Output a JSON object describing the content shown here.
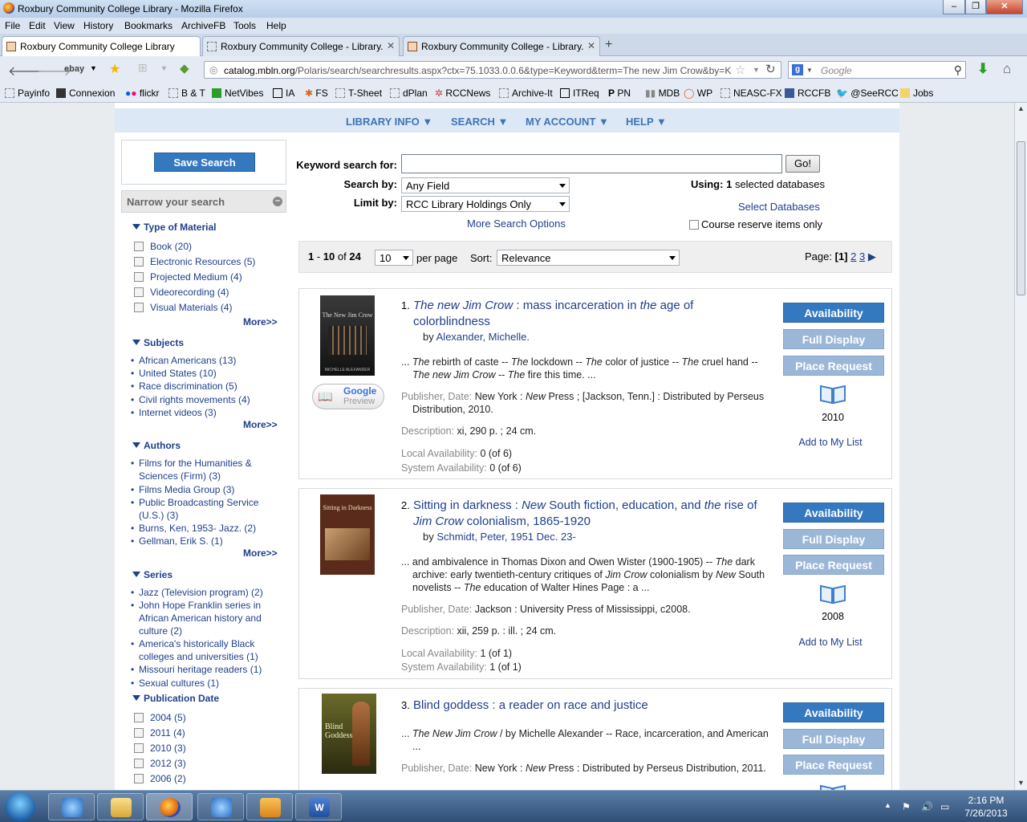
{
  "window": {
    "title": "Roxbury Community College Library - Mozilla Firefox"
  },
  "menu": [
    "File",
    "Edit",
    "View",
    "History",
    "Bookmarks",
    "ArchiveFB",
    "Tools",
    "Help"
  ],
  "tabs": [
    {
      "label": "Roxbury Community College Library",
      "active": true
    },
    {
      "label": "Roxbury Community College - Library.",
      "active": false
    },
    {
      "label": "Roxbury Community College - Library.",
      "active": false
    }
  ],
  "nav": {
    "url_domain": "catalog.mbln.org",
    "url_path": "/Polaris/search/searchresults.aspx?ctx=75.1033.0.0.6&type=Keyword&term=The new Jim Crow&by=K",
    "ebay": "ebay",
    "search_placeholder": "Google"
  },
  "bookmarks": [
    "Payinfo",
    "Connexion",
    "flickr",
    "B & T",
    "NetVibes",
    "IA",
    "FS",
    "T-Sheet",
    "dPlan",
    "RCCNews",
    "Archive-It",
    "ITReq",
    "PN",
    "MDB",
    "WP",
    "NEASC-FX",
    "RCCFB",
    "@SeeRCC",
    "Jobs"
  ],
  "site_nav": [
    "LIBRARY INFO ▼",
    "SEARCH ▼",
    "MY ACCOUNT ▼",
    "HELP ▼"
  ],
  "sidebar": {
    "save_search": "Save Search",
    "narrow_title": "Narrow your search",
    "more": "More>>",
    "type_of_material": {
      "title": "Type of Material",
      "items": [
        "Book (20)",
        "Electronic Resources (5)",
        "Projected Medium (4)",
        "Videorecording (4)",
        "Visual Materials (4)"
      ]
    },
    "subjects": {
      "title": "Subjects",
      "items": [
        "African Americans (13)",
        "United States (10)",
        "Race discrimination (5)",
        "Civil rights movements (4)",
        "Internet videos (3)"
      ]
    },
    "authors": {
      "title": "Authors",
      "items": [
        "Films for the Humanities & Sciences (Firm) (3)",
        "Films Media Group (3)",
        "Public Broadcasting Service (U.S.) (3)",
        "Burns, Ken, 1953- Jazz. (2)",
        "Gellman, Erik S. (1)"
      ]
    },
    "series": {
      "title": "Series",
      "items": [
        "Jazz (Television program) (2)",
        "John Hope Franklin series in African American history and culture (2)",
        "America's historically Black colleges and universities (1)",
        "Missouri heritage readers (1)",
        "Sexual cultures (1)"
      ]
    },
    "pub_date": {
      "title": "Publication Date",
      "items": [
        "2004 (5)",
        "2011 (4)",
        "2010 (3)",
        "2012 (3)",
        "2006 (2)"
      ]
    }
  },
  "search": {
    "keyword_label": "Keyword search for:",
    "keyword_value": "",
    "go": "Go!",
    "search_by_label": "Search by:",
    "search_by_value": "Any Field",
    "limit_by_label": "Limit by:",
    "limit_by_value": "RCC Library Holdings Only",
    "more_options": "More Search Options",
    "using_label": "Using:",
    "using_count": "1",
    "using_suffix": "selected databases",
    "select_databases": "Select Databases",
    "course_reserve": "Course reserve items only"
  },
  "results_bar": {
    "range_start": "1",
    "range_end": "10",
    "of_label": "of",
    "total": "24",
    "per_page_value": "10",
    "per_page_label": "per page",
    "sort_label": "Sort:",
    "sort_value": "Relevance",
    "page_label": "Page:",
    "current_page": "[1]",
    "pages": [
      "2",
      "3"
    ]
  },
  "labels": {
    "availability": "Availability",
    "full_display": "Full Display",
    "place_request": "Place Request",
    "add_to_list": "Add to My List",
    "by": "by",
    "publisher_date": "Publisher, Date:",
    "description": "Description:",
    "local_avail": "Local Availability:",
    "system_avail": "System Availability:",
    "google_preview": "Google",
    "preview": "Preview"
  },
  "results": [
    {
      "num": "1.",
      "title_html": "<i>The new Jim Crow</i> : mass incarceration in <i>the</i> age of colorblindness",
      "author": "Alexander, Michelle.",
      "snippet_html": "... <i>The</i> rebirth of caste -- <i>The</i> lockdown -- <i>The</i> color of justice -- <i>The</i> cruel hand -- <i>The new Jim Crow</i> -- <i>The</i> fire this time. ...",
      "publisher_html": "New York : <i>New</i> Press ; [Jackson, Tenn.] : Distributed by Perseus Distribution, 2010.",
      "description": "xi, 290 p. ; 24 cm.",
      "local": "0 (of 6)",
      "system": "0 (of 6)",
      "year": "2010",
      "cover_title": "The New Jim Crow",
      "cover_author": "MICHELLE ALEXANDER"
    },
    {
      "num": "2.",
      "title_html": "Sitting in darkness : <i>New</i> South fiction, education, and <i>the</i> rise of <i>Jim Crow</i> colonialism, 1865-1920",
      "author": "Schmidt, Peter, 1951 Dec. 23-",
      "snippet_html": "... and ambivalence in Thomas Dixon and Owen Wister (1900-1905) -- <i>The</i> dark archive: early twentieth-century critiques of <i>Jim Crow</i> colonialism by <i>New</i> South novelists -- <i>The</i> education of Walter Hines Page : a ...",
      "publisher_html": "Jackson : University Press of Mississippi, c2008.",
      "description": "xii, 259 p. : ill. ; 24 cm.",
      "local": "1 (of 1)",
      "system": "1 (of 1)",
      "year": "2008",
      "cover_title": "Sitting in Darkness"
    },
    {
      "num": "3.",
      "title_html": "Blind goddess : a reader on race and justice",
      "snippet_html": "... <i>The New Jim Crow</i> / by Michelle Alexander -- Race, incarceration, and American ...",
      "publisher_html": "New York : <i>New</i> Press : Distributed by Perseus Distribution, 2011.",
      "cover_title": "Blind Goddess"
    }
  ],
  "taskbar": {
    "time": "2:16 PM",
    "date": "7/26/2013"
  },
  "colors": {
    "accent": "#3478bf",
    "link": "#1f3f8a",
    "nav_bg": "#dce8f5"
  }
}
